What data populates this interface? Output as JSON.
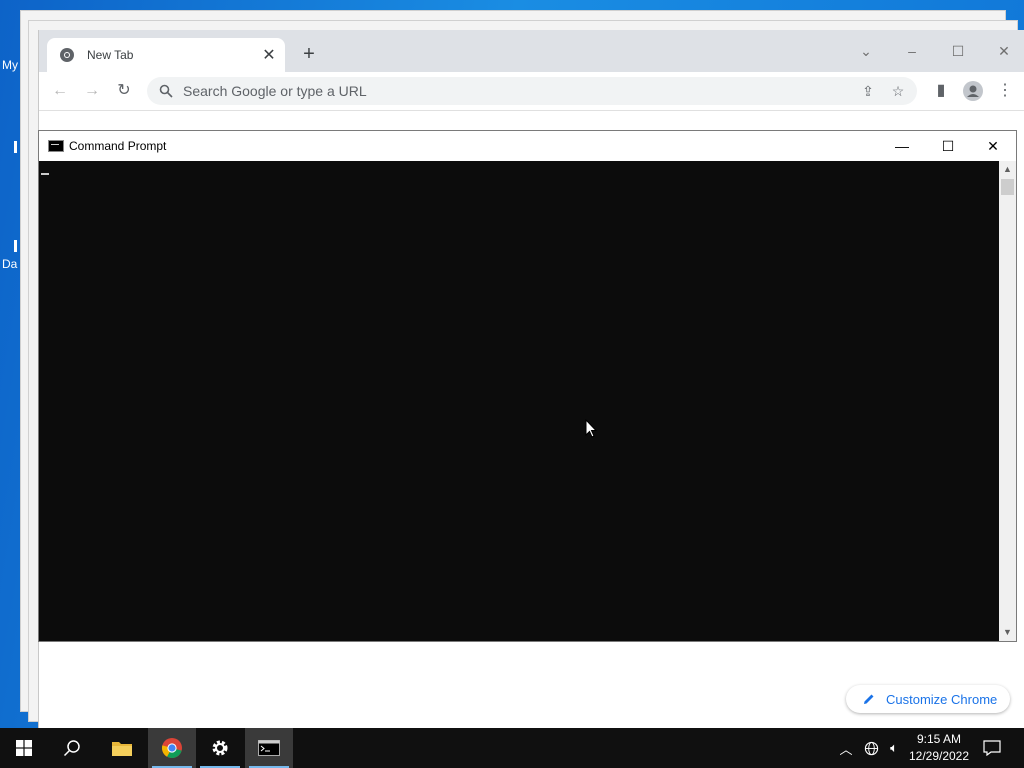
{
  "desktop": {
    "icon_labels": [
      "My",
      "Da"
    ]
  },
  "chrome": {
    "tab": {
      "title": "New Tab"
    },
    "omnibox": {
      "placeholder": "Search Google or type a URL"
    },
    "customize_label": "Customize Chrome",
    "icons": [
      "chrome-favicon",
      "close-icon",
      "plus-icon",
      "chevron-down-icon",
      "minimize-icon",
      "maximize-icon",
      "close-icon",
      "back-arrow-icon",
      "forward-arrow-icon",
      "reload-icon",
      "search-icon",
      "share-icon",
      "star-icon",
      "side-panel-icon",
      "profile-icon",
      "kebab-menu-icon",
      "pencil-icon"
    ]
  },
  "cmd": {
    "title": "Command Prompt",
    "icons": [
      "console-icon",
      "minimize-icon",
      "maximize-icon",
      "close-icon",
      "scroll-up-icon",
      "scroll-down-icon"
    ]
  },
  "taskbar": {
    "items": [
      "windows-start-icon",
      "search-icon",
      "file-explorer-icon",
      "chrome-icon",
      "settings-gear-icon",
      "command-prompt-icon"
    ],
    "tray_icons": [
      "chevron-up-icon",
      "network-icon",
      "volume-icon",
      "notification-icon"
    ],
    "clock": {
      "time": "9:15 AM",
      "date": "12/29/2022"
    }
  },
  "colors": {
    "desktop_blue": "#0a78d7",
    "taskbar": "#101010",
    "console_bg": "#0c0c0c",
    "chrome_accent": "#1a73e8",
    "taskbar_active_underline": "#76b9ed"
  }
}
